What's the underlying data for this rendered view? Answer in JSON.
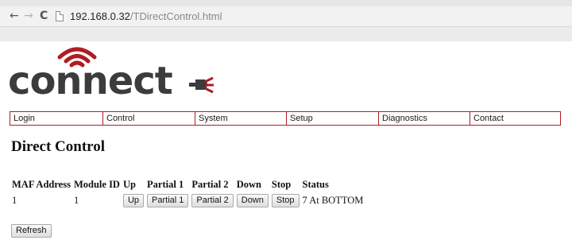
{
  "browser": {
    "back_icon": "←",
    "forward_icon": "→",
    "reload_icon": "C",
    "url_host": "192.168.0.32",
    "url_path": "/TDirectControl.html"
  },
  "logo": {
    "text": "connect"
  },
  "menu": [
    {
      "label": "Login"
    },
    {
      "label": "Control"
    },
    {
      "label": "System"
    },
    {
      "label": "Setup"
    },
    {
      "label": "Diagnostics"
    },
    {
      "label": "Contact"
    }
  ],
  "page": {
    "title": "Direct Control"
  },
  "table": {
    "headers": [
      "MAF Address",
      "Module ID",
      "Up",
      "Partial 1",
      "Partial 2",
      "Down",
      "Stop",
      "Status"
    ],
    "rows": [
      {
        "maf_address": "1",
        "module_id": "1",
        "up": "Up",
        "partial1": "Partial 1",
        "partial2": "Partial 2",
        "down": "Down",
        "stop": "Stop",
        "status": "7 At BOTTOM"
      }
    ]
  },
  "refresh_label": "Refresh",
  "colors": {
    "brand_red": "#b01c24",
    "logo_gray": "#3c3c3c"
  }
}
